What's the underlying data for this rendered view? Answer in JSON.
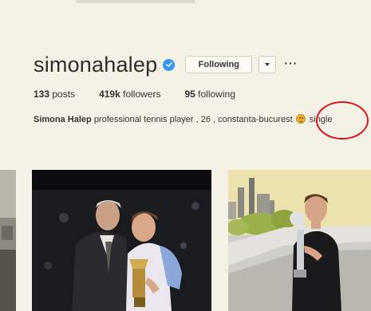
{
  "profile": {
    "username": "simonahalep",
    "verified": true,
    "following_button": "Following",
    "dropdown": "dropdown",
    "more": "···"
  },
  "stats": {
    "posts_count": "133",
    "posts_label": "posts",
    "followers_count": "419k",
    "followers_label": "followers",
    "following_count": "95",
    "following_label": "following"
  },
  "bio": {
    "name": "Simona Halep",
    "text": "professional tennis player , 26 , constanta-bucurest",
    "emoji": "😊",
    "after_emoji": "single"
  },
  "annotation": {
    "color": "#d5161d"
  },
  "colors": {
    "background": "#f4f2e7",
    "verified": "#3897f0"
  }
}
